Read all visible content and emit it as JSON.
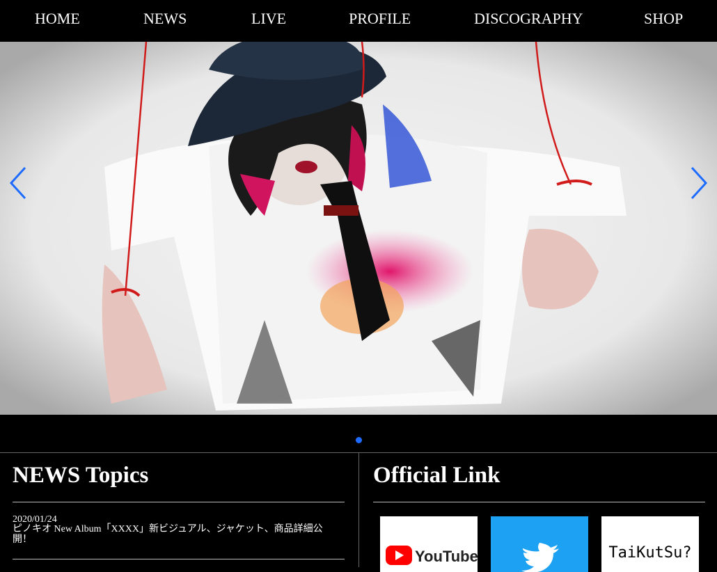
{
  "nav": {
    "items": [
      {
        "label": "HOME"
      },
      {
        "label": "NEWS"
      },
      {
        "label": "LIVE"
      },
      {
        "label": "PROFILE"
      },
      {
        "label": "DISCOGRAPHY"
      },
      {
        "label": "SHOP"
      }
    ]
  },
  "hero": {
    "prev_icon": "chevron-left",
    "next_icon": "chevron-right",
    "accent": "#1e6cff"
  },
  "news": {
    "title": "NEWS Topics",
    "items": [
      {
        "date": "2020/01/24",
        "text": "ピノキオ New Album「XXXX」新ビジュアル、ジャケット、商品詳細公開！"
      }
    ]
  },
  "links": {
    "title": "Official Link",
    "tiles": [
      {
        "name": "YouTube",
        "icon": "youtube-logo"
      },
      {
        "name": "Twitter",
        "icon": "twitter-bird"
      },
      {
        "name": "TaiKutSu?",
        "icon": "taikutsu-logo"
      }
    ]
  }
}
